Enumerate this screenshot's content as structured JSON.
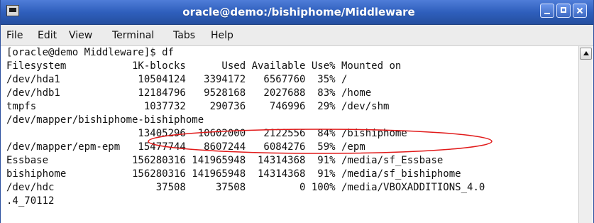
{
  "window": {
    "title": "oracle@demo:/bishiphome/Middleware"
  },
  "menu": {
    "file": "File",
    "edit": "Edit",
    "view": "View",
    "terminal": "Terminal",
    "tabs": "Tabs",
    "help": "Help"
  },
  "terminal": {
    "lines": [
      "[oracle@demo Middleware]$ df",
      "Filesystem           1K-blocks      Used Available Use% Mounted on",
      "/dev/hda1             10504124   3394172   6567760  35% /",
      "/dev/hdb1             12184796   9528168   2027688  83% /home",
      "tmpfs                  1037732    290736    746996  29% /dev/shm",
      "/dev/mapper/bishiphome-bishiphome",
      "                      13405296  10602000   2122556  84% /bishiphome",
      "/dev/mapper/epm-epm   15477744   8607244   6084276  59% /epm",
      "Essbase              156280316 141965948  14314368  91% /media/sf_Essbase",
      "bishiphome           156280316 141965948  14314368  91% /media/sf_bishiphome",
      "/dev/hdc                 37508     37508         0 100% /media/VBOXADDITIONS_4.0",
      ".4_70112",
      ""
    ]
  },
  "colors": {
    "titlebar": "#2f5fbd",
    "annotation": "#e11a1a",
    "terminal_background": "#ffffff",
    "terminal_text": "#111111"
  },
  "icons": {
    "window_app": "terminal-app-icon",
    "minimize": "minimize-icon",
    "maximize": "maximize-icon",
    "close": "close-icon",
    "scroll_up": "scroll-up-icon"
  }
}
